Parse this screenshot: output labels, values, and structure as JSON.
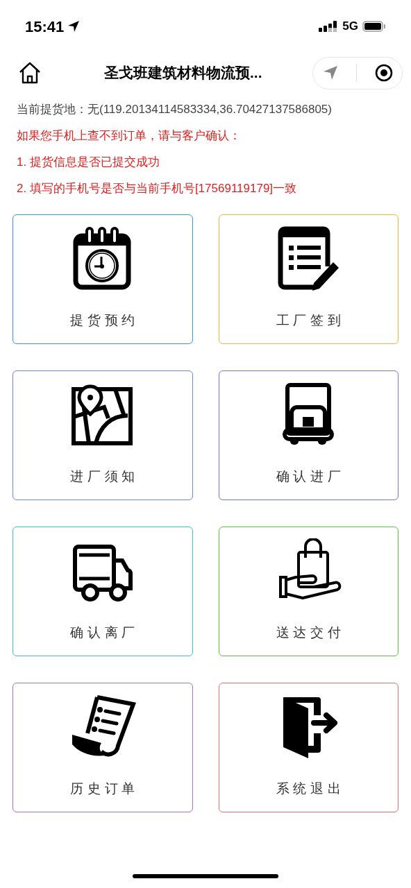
{
  "status_bar": {
    "time": "15:41",
    "network": "5G"
  },
  "nav": {
    "title": "圣戈班建筑材料物流预..."
  },
  "info": {
    "location_label": "当前提货地：无(119.20134114583334,36.70427137586805)",
    "notice_lines": [
      "如果您手机上查不到订单，请与客户确认：",
      "1. 提货信息是否已提交成功",
      "2. 填写的手机号是否与当前手机号[17569119179]一致"
    ]
  },
  "tiles": [
    {
      "label": "提货预约",
      "color": "#3b95e8"
    },
    {
      "label": "工厂签到",
      "color": "#f0b43a"
    },
    {
      "label": "进厂须知",
      "color": "#6a88d4"
    },
    {
      "label": "确认进厂",
      "color": "#7477cf"
    },
    {
      "label": "确认离厂",
      "color": "#3cc4c8"
    },
    {
      "label": "送达交付",
      "color": "#62c044"
    },
    {
      "label": "历史订单",
      "color": "#a474c4"
    },
    {
      "label": "系统退出",
      "color": "#e07272"
    }
  ]
}
